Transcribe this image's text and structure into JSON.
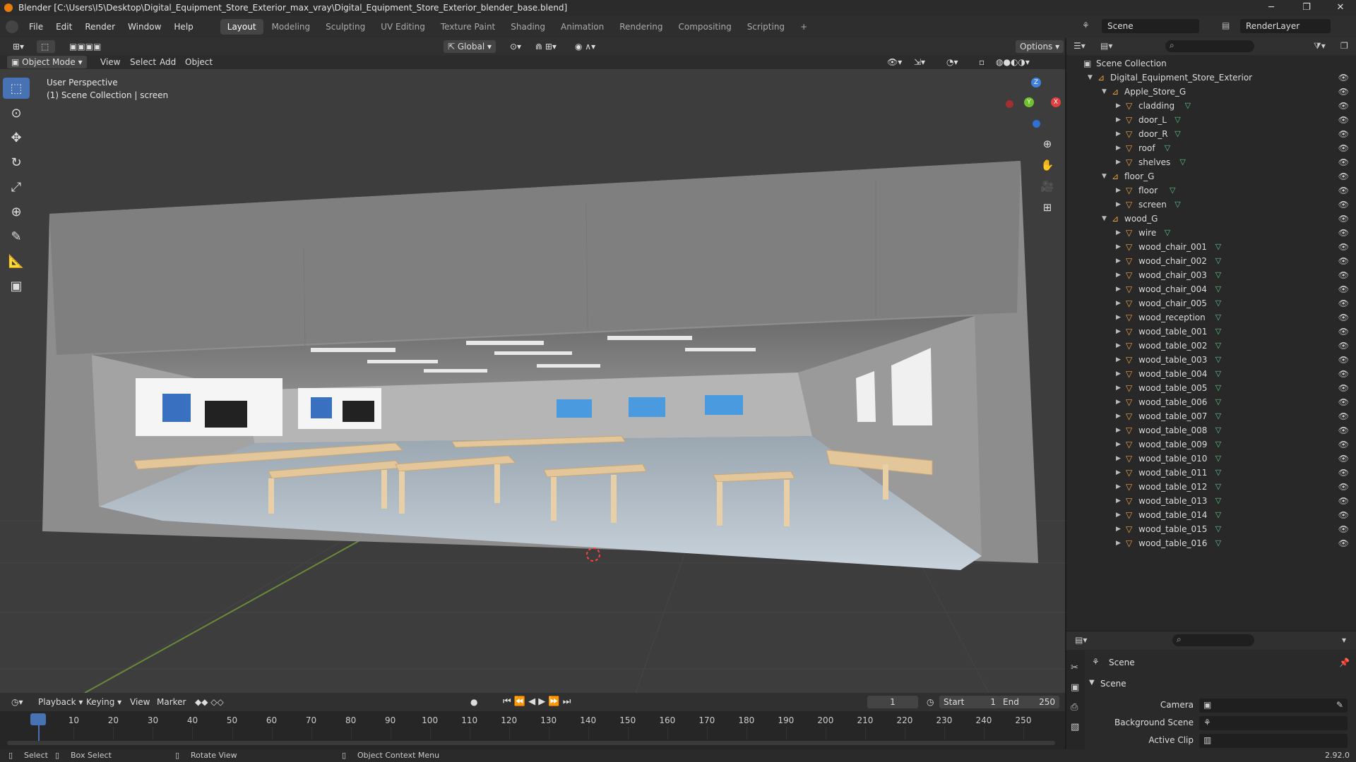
{
  "window": {
    "title": "Blender [C:\\Users\\I5\\Desktop\\Digital_Equipment_Store_Exterior_max_vray\\Digital_Equipment_Store_Exterior_blender_base.blend]"
  },
  "menu": [
    "File",
    "Edit",
    "Render",
    "Window",
    "Help"
  ],
  "workspaces": [
    "Layout",
    "Modeling",
    "Sculpting",
    "UV Editing",
    "Texture Paint",
    "Shading",
    "Animation",
    "Rendering",
    "Compositing",
    "Scripting"
  ],
  "active_workspace": "Layout",
  "scene_name": "Scene",
  "view_layer": "RenderLayer",
  "viewport": {
    "transform_orientation": "Global",
    "options_label": "Options",
    "mode": "Object Mode",
    "header_menus": [
      "View",
      "Select",
      "Add",
      "Object"
    ],
    "overlay_line1": "User Perspective",
    "overlay_line2": "(1) Scene Collection | screen",
    "gizmo_labels": {
      "x": "X",
      "y": "Y",
      "z": "Z"
    }
  },
  "outliner": {
    "root": "Scene Collection",
    "items": [
      {
        "label": "Digital_Equipment_Store_Exterior",
        "kind": "collection",
        "level": 0,
        "expanded": true
      },
      {
        "label": "Apple_Store_G",
        "kind": "collection",
        "level": 1,
        "expanded": true
      },
      {
        "label": "cladding",
        "kind": "object",
        "level": 2
      },
      {
        "label": "door_L",
        "kind": "object",
        "level": 2
      },
      {
        "label": "door_R",
        "kind": "object",
        "level": 2
      },
      {
        "label": "roof",
        "kind": "object",
        "level": 2
      },
      {
        "label": "shelves",
        "kind": "object",
        "level": 2
      },
      {
        "label": "floor_G",
        "kind": "collection",
        "level": 1,
        "expanded": true
      },
      {
        "label": "floor",
        "kind": "object",
        "level": 2
      },
      {
        "label": "screen",
        "kind": "object",
        "level": 2
      },
      {
        "label": "wood_G",
        "kind": "collection",
        "level": 1,
        "expanded": true
      },
      {
        "label": "wire",
        "kind": "object",
        "level": 2
      },
      {
        "label": "wood_chair_001",
        "kind": "object",
        "level": 2
      },
      {
        "label": "wood_chair_002",
        "kind": "object",
        "level": 2
      },
      {
        "label": "wood_chair_003",
        "kind": "object",
        "level": 2
      },
      {
        "label": "wood_chair_004",
        "kind": "object",
        "level": 2
      },
      {
        "label": "wood_chair_005",
        "kind": "object",
        "level": 2
      },
      {
        "label": "wood_reception",
        "kind": "object",
        "level": 2
      },
      {
        "label": "wood_table_001",
        "kind": "object",
        "level": 2
      },
      {
        "label": "wood_table_002",
        "kind": "object",
        "level": 2
      },
      {
        "label": "wood_table_003",
        "kind": "object",
        "level": 2
      },
      {
        "label": "wood_table_004",
        "kind": "object",
        "level": 2
      },
      {
        "label": "wood_table_005",
        "kind": "object",
        "level": 2
      },
      {
        "label": "wood_table_006",
        "kind": "object",
        "level": 2
      },
      {
        "label": "wood_table_007",
        "kind": "object",
        "level": 2
      },
      {
        "label": "wood_table_008",
        "kind": "object",
        "level": 2
      },
      {
        "label": "wood_table_009",
        "kind": "object",
        "level": 2
      },
      {
        "label": "wood_table_010",
        "kind": "object",
        "level": 2
      },
      {
        "label": "wood_table_011",
        "kind": "object",
        "level": 2
      },
      {
        "label": "wood_table_012",
        "kind": "object",
        "level": 2
      },
      {
        "label": "wood_table_013",
        "kind": "object",
        "level": 2
      },
      {
        "label": "wood_table_014",
        "kind": "object",
        "level": 2
      },
      {
        "label": "wood_table_015",
        "kind": "object",
        "level": 2
      },
      {
        "label": "wood_table_016",
        "kind": "object",
        "level": 2
      }
    ]
  },
  "properties": {
    "context": "Scene",
    "panel": "Scene",
    "fields": [
      {
        "label": "Camera"
      },
      {
        "label": "Background Scene"
      },
      {
        "label": "Active Clip"
      }
    ]
  },
  "timeline": {
    "menus": [
      "Playback",
      "Keying",
      "View",
      "Marker"
    ],
    "current_frame": "1",
    "start_label": "Start",
    "start": "1",
    "end_label": "End",
    "end": "250",
    "ticks": [
      "1",
      "10",
      "20",
      "30",
      "40",
      "50",
      "60",
      "70",
      "80",
      "90",
      "100",
      "110",
      "120",
      "130",
      "140",
      "150",
      "160",
      "170",
      "180",
      "190",
      "200",
      "210",
      "220",
      "230",
      "240",
      "250"
    ],
    "playhead_frame": 1
  },
  "statusbar": {
    "select": "Select",
    "box_select": "Box Select",
    "rotate_view": "Rotate View",
    "context_menu": "Object Context Menu",
    "version": "2.92.0"
  }
}
